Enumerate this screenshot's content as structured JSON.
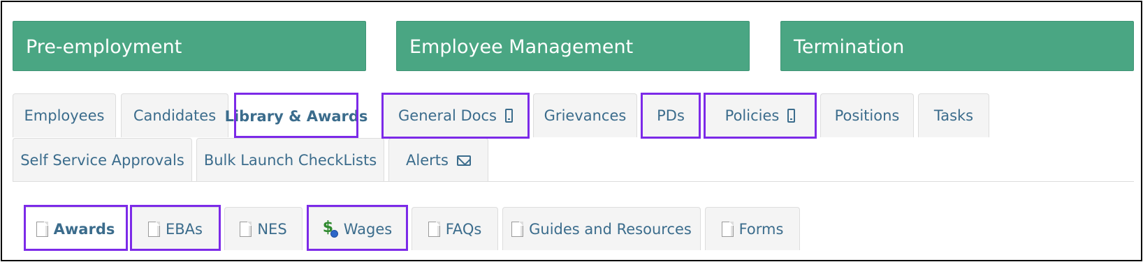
{
  "sections": [
    {
      "label": "Pre-employment"
    },
    {
      "label": "Employee Management"
    },
    {
      "label": "Termination"
    }
  ],
  "main_tabs": {
    "row1": [
      {
        "label": "Employees"
      },
      {
        "label": "Candidates"
      },
      {
        "label": "Library & Awards",
        "active": true
      },
      {
        "label": "General Docs",
        "icon": "mobile-phone-icon"
      },
      {
        "label": "Grievances"
      },
      {
        "label": "PDs"
      },
      {
        "label": "Policies",
        "icon": "mobile-phone-icon"
      },
      {
        "label": "Positions"
      },
      {
        "label": "Tasks"
      }
    ],
    "row2": [
      {
        "label": "Self Service Approvals"
      },
      {
        "label": "Bulk Launch CheckLists"
      },
      {
        "label": "Alerts",
        "icon": "envelope-icon"
      }
    ]
  },
  "sub_tabs": [
    {
      "label": "Awards",
      "icon": "document-icon",
      "active": true
    },
    {
      "label": "EBAs",
      "icon": "document-icon"
    },
    {
      "label": "NES",
      "icon": "document-icon"
    },
    {
      "label": "Wages",
      "icon": "money-icon"
    },
    {
      "label": "FAQs",
      "icon": "document-icon"
    },
    {
      "label": "Guides and Resources",
      "icon": "document-icon"
    },
    {
      "label": "Forms",
      "icon": "document-icon"
    }
  ],
  "colors": {
    "section_green": "#4aa683",
    "tab_text": "#3b6c8c",
    "highlight": "#7c2ae8"
  }
}
